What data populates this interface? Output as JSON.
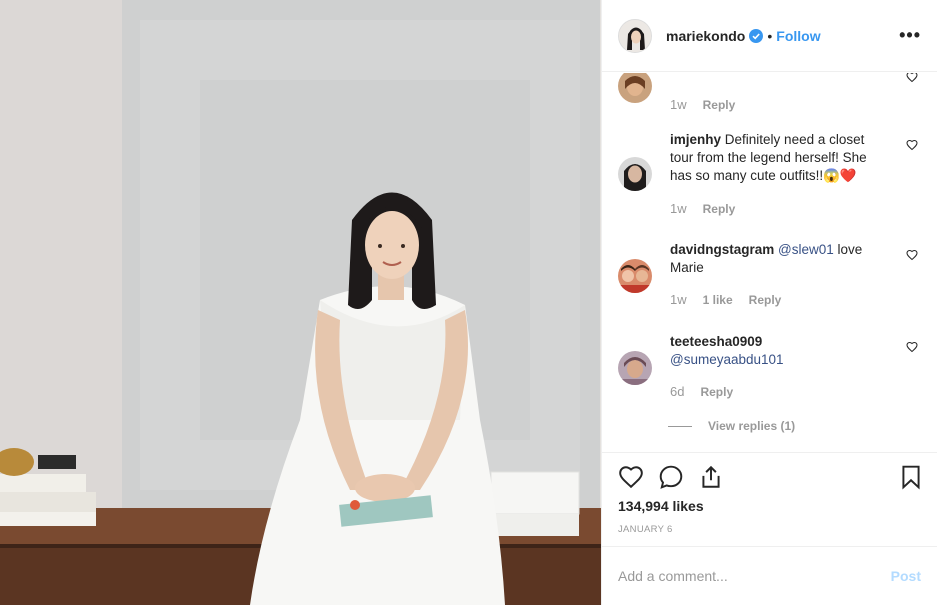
{
  "header": {
    "username": "mariekondo",
    "separator": "•",
    "follow_label": "Follow",
    "more_label": "•••"
  },
  "comments": [
    {
      "username": "",
      "text": "",
      "time": "1w",
      "actions": [
        "Reply"
      ]
    },
    {
      "username": "imjenhy",
      "text": "Definitely need a closet tour from the legend herself! She has so many cute outfits!!😱❤️",
      "time": "1w",
      "actions": [
        "Reply"
      ]
    },
    {
      "username": "davidngstagram",
      "mention": "@slew01",
      "text": "love Marie",
      "time": "1w",
      "actions": [
        "1 like",
        "Reply"
      ]
    },
    {
      "username": "teeteesha0909",
      "mention": "@sumeyaabdu101",
      "text": "",
      "time": "6d",
      "actions": [
        "Reply"
      ]
    }
  ],
  "view_replies": "View replies (1)",
  "likes": "134,994 likes",
  "date": "JANUARY 6",
  "add_comment": {
    "placeholder": "Add a comment...",
    "post_label": "Post"
  },
  "colors": {
    "link_blue": "#3897f0",
    "mention": "#385185",
    "muted": "#999999",
    "text": "#262626"
  }
}
